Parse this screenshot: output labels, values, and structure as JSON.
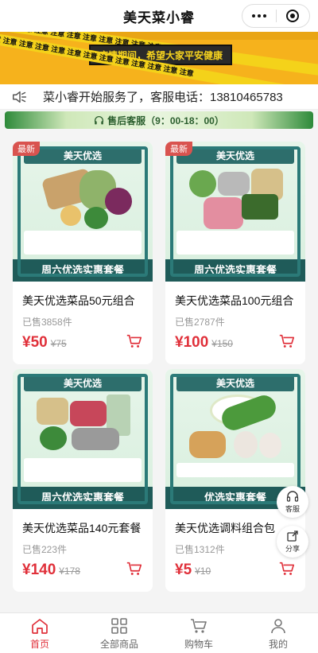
{
  "app": {
    "title": "美天菜小睿"
  },
  "banner": {
    "slogan": "疫情期间，希望大家平安健康",
    "tape_text": "注意 注意 注意 注意 注意 注意 注意 注意 注意 注意 注意 注意 注意"
  },
  "notice": {
    "text": "菜小睿开始服务了，客服电话：13810465783"
  },
  "service": {
    "text": "售后客服（9：00-18：00）"
  },
  "products": [
    {
      "ribbon": "最新",
      "header": "美天优选",
      "footer": "周六优选实惠套餐",
      "name": "美天优选菜品50元组合",
      "sold": "已售3858件",
      "price": "¥50",
      "old_price": "¥75"
    },
    {
      "ribbon": "最新",
      "header": "美天优选",
      "footer": "周六优选实惠套餐",
      "name": "美天优选菜品100元组合",
      "sold": "已售2787件",
      "price": "¥100",
      "old_price": "¥150"
    },
    {
      "ribbon": "",
      "header": "美天优选",
      "footer": "周六优选实惠套餐",
      "name": "美天优选菜品140元套餐",
      "sold": "已售223件",
      "price": "¥140",
      "old_price": "¥178"
    },
    {
      "ribbon": "",
      "header": "美天优选",
      "footer": "优选实惠套餐",
      "name": "美天优选调料组合包",
      "sold": "已售1312件",
      "price": "¥5",
      "old_price": "¥10"
    }
  ],
  "float": {
    "service_label": "客服",
    "share_label": "分享"
  },
  "tabs": [
    {
      "label": "首页",
      "icon": "home-icon"
    },
    {
      "label": "全部商品",
      "icon": "grid-icon"
    },
    {
      "label": "购物车",
      "icon": "cart-icon"
    },
    {
      "label": "我的",
      "icon": "user-icon"
    }
  ],
  "colors": {
    "accent": "#e0303a",
    "banner": "#f6b21c",
    "theme_green": "#2b7a78"
  }
}
